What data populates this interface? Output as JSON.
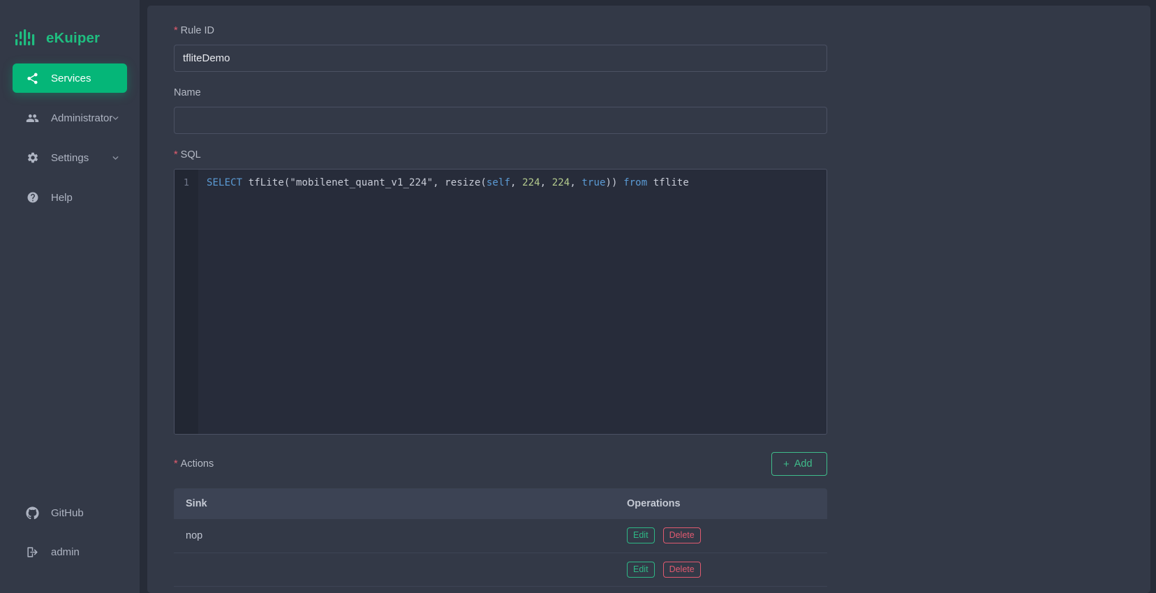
{
  "brand": {
    "name": "eKuiper",
    "logo_icon": "equalizer-bars-icon",
    "color": "#1fbe80"
  },
  "sidebar": {
    "items": [
      {
        "label": "Services",
        "icon": "share-nodes-icon",
        "active": true,
        "expandable": false
      },
      {
        "label": "Administrator",
        "icon": "people-icon",
        "active": false,
        "expandable": true
      },
      {
        "label": "Settings",
        "icon": "gear-icon",
        "active": false,
        "expandable": true
      },
      {
        "label": "Help",
        "icon": "help-circle-icon",
        "active": false,
        "expandable": false
      }
    ],
    "bottom_items": [
      {
        "label": "GitHub",
        "icon": "github-icon"
      },
      {
        "label": "admin",
        "icon": "logout-icon"
      }
    ]
  },
  "form": {
    "rule_id": {
      "label": "Rule ID",
      "required_marker": "*",
      "value": "tfliteDemo",
      "placeholder": ""
    },
    "name": {
      "label": "Name",
      "required_marker": "",
      "value": "",
      "placeholder": ""
    },
    "sql": {
      "label": "SQL",
      "required_marker": "*",
      "line_number": "1",
      "text": "SELECT tfLite(\"mobilenet_quant_v1_224\", resize(self, 224, 224, true)) from tflite",
      "tokens": [
        {
          "t": "SELECT",
          "c": "kw"
        },
        {
          "t": " tfLite(",
          "c": "pn"
        },
        {
          "t": "\"mobilenet_quant_v1_224\"",
          "c": "str"
        },
        {
          "t": ", resize(",
          "c": "pn"
        },
        {
          "t": "self",
          "c": "blue"
        },
        {
          "t": ", ",
          "c": "pn"
        },
        {
          "t": "224",
          "c": "num"
        },
        {
          "t": ", ",
          "c": "pn"
        },
        {
          "t": "224",
          "c": "num"
        },
        {
          "t": ", ",
          "c": "pn"
        },
        {
          "t": "true",
          "c": "blue"
        },
        {
          "t": ")) ",
          "c": "pn"
        },
        {
          "t": "from",
          "c": "blue"
        },
        {
          "t": " tflite",
          "c": "pn"
        }
      ]
    },
    "actions": {
      "label": "Actions",
      "required_marker": "*",
      "add_button": {
        "label": "Add",
        "icon": "plus-icon"
      }
    }
  },
  "table": {
    "columns": [
      "Sink",
      "Operations"
    ],
    "rows": [
      {
        "sink": "nop",
        "operations": [
          {
            "label": "Edit",
            "kind": "edit"
          },
          {
            "label": "Delete",
            "kind": "delete"
          }
        ]
      },
      {
        "sink": "",
        "operations": [
          {
            "label": "Edit",
            "kind": "edit"
          },
          {
            "label": "Delete",
            "kind": "delete"
          }
        ]
      }
    ]
  },
  "colors": {
    "accent_green": "#05b678",
    "brand_green": "#1fbe80",
    "required_red": "#e45c6e",
    "delete_red": "#e05a70",
    "panel_bg": "#333947",
    "page_bg": "#272c38",
    "editor_bg": "#272c3a"
  }
}
